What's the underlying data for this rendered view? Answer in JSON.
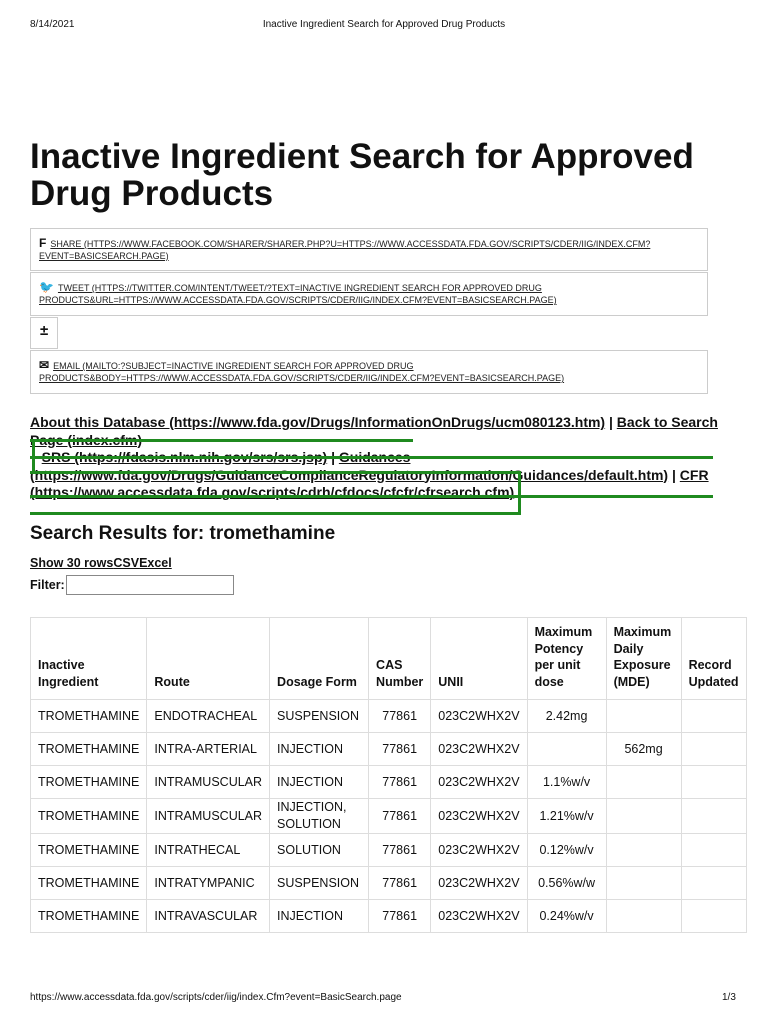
{
  "header": {
    "date": "8/14/2021",
    "title": "Inactive Ingredient Search for Approved Drug Products"
  },
  "page_title": "Inactive Ingredient Search for Approved Drug Products",
  "share": {
    "facebook": "SHARE (HTTPS://WWW.FACEBOOK.COM/SHARER/SHARER.PHP?U=HTTPS://WWW.ACCESSDATA.FDA.GOV/SCRIPTS/CDER/IIG/INDEX.CFM?EVENT=BASICSEARCH.PAGE)",
    "twitter": "TWEET (HTTPS://TWITTER.COM/INTENT/TWEET/?TEXT=INACTIVE INGREDIENT SEARCH FOR APPROVED DRUG PRODUCTS&URL=HTTPS://WWW.ACCESSDATA.FDA.GOV/SCRIPTS/CDER/IIG/INDEX.CFM?EVENT=BASICSEARCH.PAGE)",
    "plus": "±",
    "email": "EMAIL (MAILTO:?SUBJECT=INACTIVE INGREDIENT SEARCH FOR APPROVED DRUG PRODUCTS&BODY=HTTPS://WWW.ACCESSDATA.FDA.GOV/SCRIPTS/CDER/IIG/INDEX.CFM?EVENT=BASICSEARCH.PAGE)"
  },
  "links": {
    "about": "About this Database (https://www.fda.gov/Drugs/InformationOnDrugs/ucm080123.htm)",
    "back": "Back to Search Page (index.cfm)",
    "srs": "SRS (https://fdasis.nlm.nih.gov/srs/srs.jsp)",
    "guidances": "Guidances (https://www.fda.gov/Drugs/GuidanceComplianceRegulatoryInformation/Guidances/default.htm)",
    "cfr": "CFR (https://www.accessdata.fda.gov/scripts/cdrh/cfdocs/cfcfr/cfrsearch.cfm)",
    "sep": "|"
  },
  "results_title": "Search Results for: tromethamine",
  "controls": {
    "show_rows": "Show 30 rows",
    "csv": "CSV",
    "excel": "Excel",
    "filter_label": "Filter:",
    "filter_value": ""
  },
  "table": {
    "headers": [
      "Inactive Ingredient",
      "Route",
      "Dosage Form",
      "CAS Number",
      "UNII",
      "Maximum Potency per unit dose",
      "Maximum Daily Exposure (MDE)",
      "Record Updated"
    ],
    "rows": [
      [
        "TROMETHAMINE",
        "ENDOTRACHEAL",
        "SUSPENSION",
        "77861",
        "023C2WHX2V",
        "2.42mg",
        "",
        ""
      ],
      [
        "TROMETHAMINE",
        "INTRA-ARTERIAL",
        "INJECTION",
        "77861",
        "023C2WHX2V",
        "",
        "562mg",
        ""
      ],
      [
        "TROMETHAMINE",
        "INTRAMUSCULAR",
        "INJECTION",
        "77861",
        "023C2WHX2V",
        "1.1%w/v",
        "",
        ""
      ],
      [
        "TROMETHAMINE",
        "INTRAMUSCULAR",
        "INJECTION, SOLUTION",
        "77861",
        "023C2WHX2V",
        "1.21%w/v",
        "",
        ""
      ],
      [
        "TROMETHAMINE",
        "INTRATHECAL",
        "SOLUTION",
        "77861",
        "023C2WHX2V",
        "0.12%w/v",
        "",
        ""
      ],
      [
        "TROMETHAMINE",
        "INTRATYMPANIC",
        "SUSPENSION",
        "77861",
        "023C2WHX2V",
        "0.56%w/w",
        "",
        ""
      ],
      [
        "TROMETHAMINE",
        "INTRAVASCULAR",
        "INJECTION",
        "77861",
        "023C2WHX2V",
        "0.24%w/v",
        "",
        ""
      ]
    ]
  },
  "footer": {
    "url": "https://www.accessdata.fda.gov/scripts/cder/iig/index.Cfm?event=BasicSearch.page",
    "page": "1/3"
  }
}
